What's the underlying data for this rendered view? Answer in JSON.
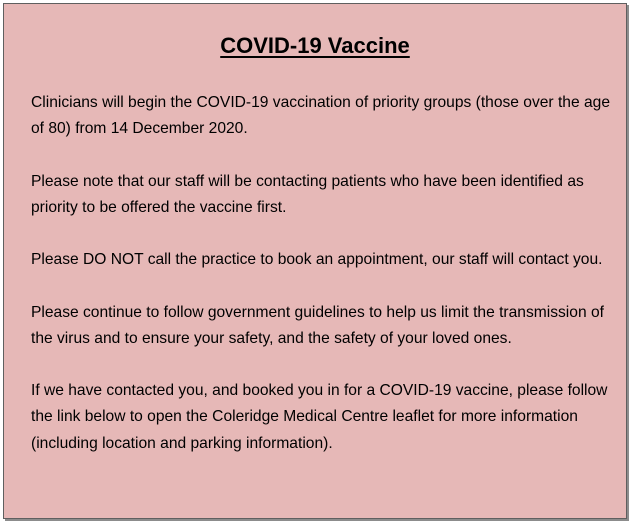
{
  "notice": {
    "title": "COVID-19 Vaccine",
    "paragraphs": [
      "Clinicians will begin the COVID-19 vaccination of priority groups (those over the age of 80) from 14 December 2020.",
      "Please note that our staff will be contacting patients who have been identified as priority to be offered the vaccine first.",
      "Please DO NOT call the practice to book an appointment, our staff will contact you.",
      "Please continue to follow government guidelines to help us limit the transmission of the virus and to ensure your safety, and the safety of your loved ones.",
      "If we have contacted you, and booked you in for a COVID-19 vaccine, please follow the link below to open the Coleridge Medical Centre leaflet for more information (including location and parking information)."
    ],
    "colors": {
      "background": "#e6b8b7",
      "border": "#5f5f5f",
      "text": "#000000"
    }
  }
}
